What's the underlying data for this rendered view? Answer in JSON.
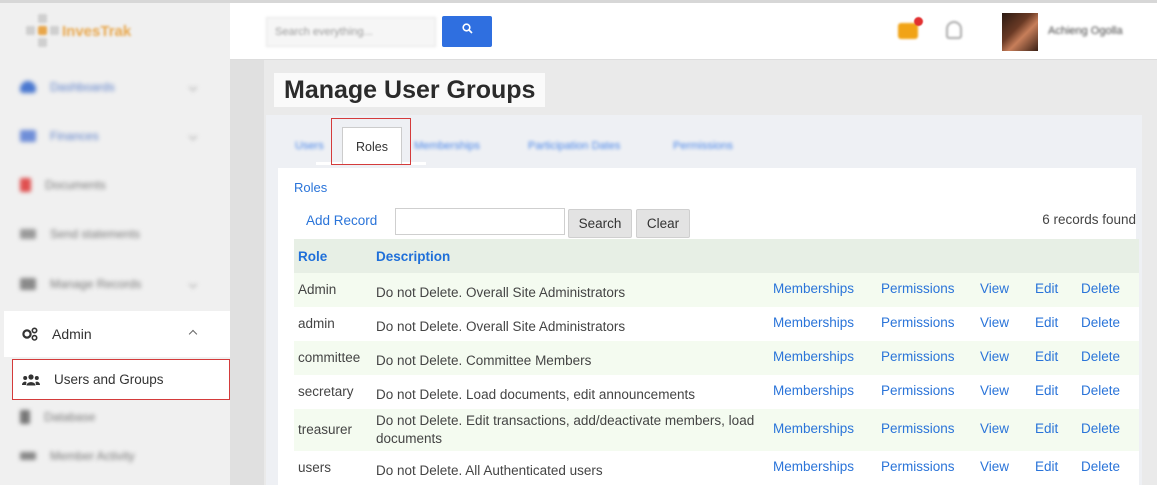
{
  "app": {
    "logo_text": "InvesTrak"
  },
  "search": {
    "placeholder": "Search everything...",
    "button_label": "Search"
  },
  "user": {
    "name": "Achieng Ogolla"
  },
  "sidebar": {
    "items": [
      {
        "label": "Dashboards",
        "icon": "cloud-icon",
        "color": "#4a78d0"
      },
      {
        "label": "Finances",
        "icon": "finance-icon",
        "color": "#6f8ed8"
      },
      {
        "label": "Documents",
        "icon": "document-icon",
        "color": "#e05050"
      },
      {
        "label": "Send statements",
        "icon": "envelope-icon",
        "color": "#9a9a9a"
      },
      {
        "label": "Manage Records",
        "icon": "records-icon",
        "color": "#8a8a8a"
      }
    ],
    "admin": {
      "label": "Admin",
      "icon": "cogs-icon"
    },
    "users_and_groups": {
      "label": "Users and Groups",
      "icon": "users-icon"
    },
    "after": [
      {
        "label": "Database",
        "icon": "database-icon"
      },
      {
        "label": "Member Activity",
        "icon": "activity-icon"
      }
    ]
  },
  "page": {
    "title": "Manage User Groups",
    "tabs": [
      {
        "label": "Users"
      },
      {
        "label": "Roles"
      },
      {
        "label": "Memberships"
      },
      {
        "label": "Participation Dates"
      },
      {
        "label": "Permissions"
      }
    ],
    "active_tab": "Roles"
  },
  "grid": {
    "crumb": "Roles",
    "add_record": "Add Record",
    "filter_value": "",
    "search_button": "Search",
    "clear_button": "Clear",
    "records_found": "6 records found",
    "columns": {
      "role": "Role",
      "description": "Description"
    },
    "actions": {
      "memberships": "Memberships",
      "permissions": "Permissions",
      "view": "View",
      "edit": "Edit",
      "delete": "Delete"
    },
    "rows": [
      {
        "role": "Admin",
        "description": "Do not Delete. Overall Site Administrators"
      },
      {
        "role": "admin",
        "description": "Do not Delete. Overall Site Administrators"
      },
      {
        "role": "committee",
        "description": "Do not Delete. Committee Members"
      },
      {
        "role": "secretary",
        "description": "Do not Delete. Load documents, edit announcements"
      },
      {
        "role": "treasurer",
        "description": "Do not Delete. Edit transactions, add/deactivate members, load documents"
      },
      {
        "role": "users",
        "description": "Do not Delete. All Authenticated users"
      }
    ]
  }
}
